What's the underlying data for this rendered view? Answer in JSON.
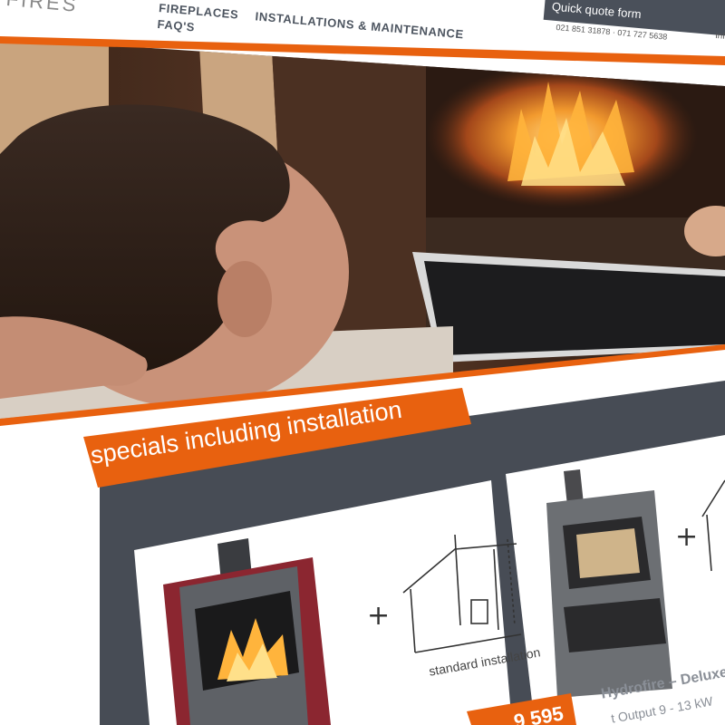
{
  "header": {
    "logo_fragment": "FIRES",
    "nav": [
      "FIREPLACES",
      "INSTALLATIONS & MAINTENANCE",
      "FAQ'S"
    ],
    "quote_button": "Quick quote form",
    "phones": "021 851 31878  ·  071 727 5638",
    "email_fragment": "inf"
  },
  "specials": {
    "title": "specials including installation",
    "cards": [
      {
        "install_label": "standard installation",
        "price_fragment": "9 595"
      },
      {
        "name": "Hydrofire – Deluxe L",
        "output": "t Output 9 - 13 kW"
      }
    ]
  },
  "colors": {
    "orange": "#e8610f",
    "slate": "#474c55",
    "stove_red": "#8b2630",
    "stove_grey": "#6c6f73"
  }
}
